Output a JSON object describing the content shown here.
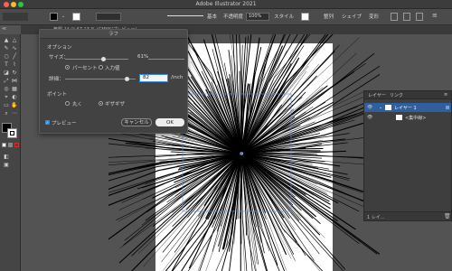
{
  "app": {
    "title": "Adobe Illustrator 2021"
  },
  "control_bar": {
    "stroke_style_label": "基本",
    "opacity_label": "不透明度",
    "opacity_value": "100%",
    "style_label": "スタイル",
    "align_label": "整列",
    "shape_label": "シェイプ",
    "transform_label": "変形"
  },
  "document_tab": {
    "label": "無題-1* @ 67.13 % (CMYK/プレビュー)"
  },
  "toolbar": {
    "panel_label": "≪"
  },
  "dialog": {
    "title": "ラフ",
    "options_heading": "オプション",
    "size_label": "サイズ：",
    "size_value": "61%",
    "size_slider_level": 0.61,
    "percent_option": "パーセント",
    "absolute_option": "入力値",
    "detail_label": "詳細：",
    "detail_value": "82",
    "detail_unit": "/inch",
    "points_heading": "ポイント",
    "smooth_option": "丸く",
    "corner_option": "ギザギザ",
    "preview_label": "プレビュー",
    "cancel_label": "キャンセル",
    "ok_label": "OK"
  },
  "layers_panel": {
    "tab_layers": "レイヤー",
    "tab_links": "リンク",
    "layer_name": "レイヤー 1",
    "sublayer_name": "<集中線>",
    "footer_count": "1 レイ..."
  },
  "colors": {
    "accent": "#3d8bd6",
    "ui_dark": "#424242",
    "artboard": "#ffffff"
  }
}
